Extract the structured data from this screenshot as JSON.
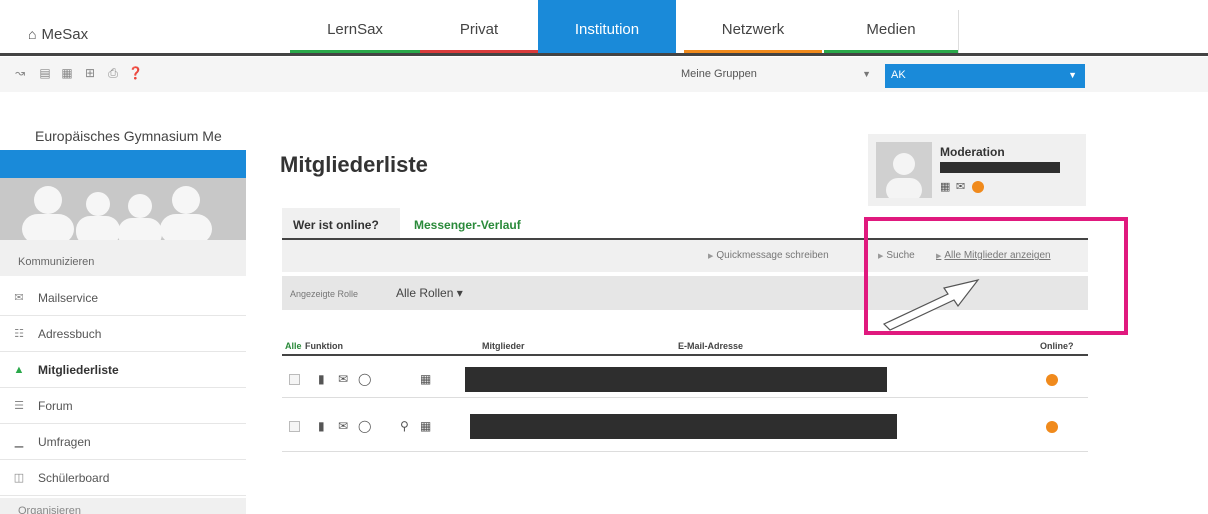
{
  "topnav": {
    "brand": "MeSax",
    "tabs": [
      {
        "label": "LernSax",
        "bar": "#2aa84a"
      },
      {
        "label": "Privat",
        "bar": "#d93b3b"
      },
      {
        "label": "Institution",
        "bar": "#1a8ad9",
        "active": true
      },
      {
        "label": "Netzwerk",
        "bar": "#f08a1c"
      },
      {
        "label": "Medien",
        "bar": "#2aa84a"
      }
    ]
  },
  "toolbar": {
    "group_select": "Meine Gruppen",
    "group_value": "AK"
  },
  "sidebar": {
    "school": "Europäisches Gymnasium Me",
    "section": "Kommunizieren",
    "items": [
      {
        "label": "Mailservice",
        "icon": "envelope-icon"
      },
      {
        "label": "Adressbuch",
        "icon": "address-book-icon"
      },
      {
        "label": "Mitgliederliste",
        "icon": "members-icon",
        "active": true
      },
      {
        "label": "Forum",
        "icon": "forum-icon"
      },
      {
        "label": "Umfragen",
        "icon": "chart-icon"
      },
      {
        "label": "Schülerboard",
        "icon": "board-icon"
      }
    ],
    "section2": "Organisieren"
  },
  "main": {
    "title": "Mitgliederliste",
    "tabs": [
      "Wer ist online?",
      "Messenger-Verlauf"
    ],
    "links": [
      "Quickmessage schreiben",
      "Suche",
      "Alle Mitglieder anzeigen"
    ],
    "filter_label": "Angezeigte Rolle",
    "filter_value": "Alle Rollen ▾",
    "moderation_title": "Moderation",
    "table": {
      "headers": [
        "Alle",
        "Funktion",
        "Mitglieder",
        "E-Mail-Adresse",
        "Online?"
      ]
    }
  },
  "colors": {
    "accent": "#1a8ad9",
    "highlight": "#e0197e",
    "online": "#f08a1c"
  }
}
